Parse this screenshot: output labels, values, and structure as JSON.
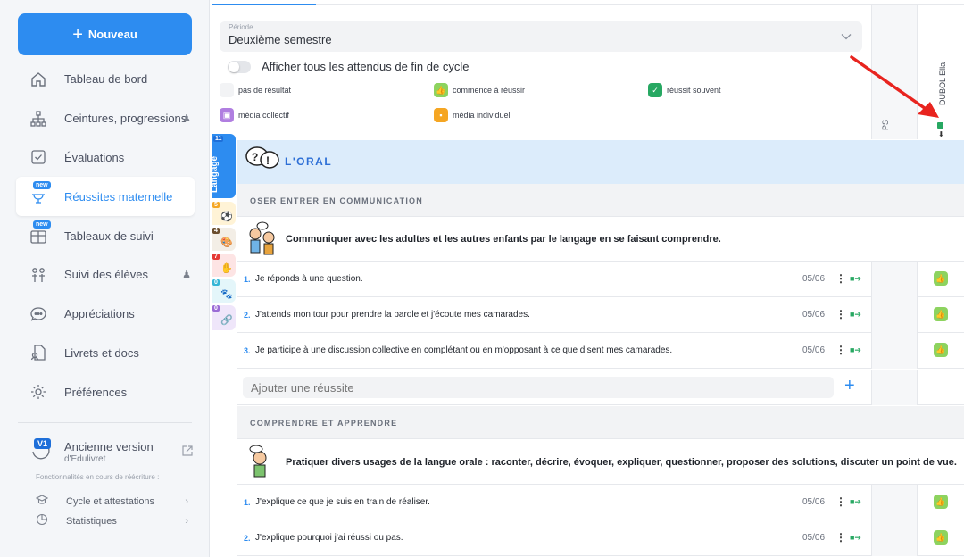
{
  "sidebar": {
    "new_button": "Nouveau",
    "items": [
      {
        "label": "Tableau de bord"
      },
      {
        "label": "Ceintures, progressions"
      },
      {
        "label": "Évaluations"
      },
      {
        "label": "Réussites maternelle",
        "badge": "new"
      },
      {
        "label": "Tableaux de suivi",
        "badge": "new"
      },
      {
        "label": "Suivi des élèves"
      },
      {
        "label": "Appréciations"
      },
      {
        "label": "Livrets et docs"
      },
      {
        "label": "Préférences"
      }
    ],
    "old_version": {
      "badge": "V1",
      "title": "Ancienne version",
      "subtitle": "d'Edulivret"
    },
    "wip_text": "Fonctionnalités en cours de réécriture :",
    "sub_items": [
      {
        "label": "Cycle et attestations"
      },
      {
        "label": "Statistiques"
      }
    ]
  },
  "filters": {
    "periode_label": "Période",
    "periode_value": "Deuxième semestre",
    "toggle_label": "Afficher tous les attendus de fin de cycle",
    "legend": [
      {
        "label": "pas de résultat"
      },
      {
        "label": "commence à réussir"
      },
      {
        "label": "réussit souvent"
      },
      {
        "label": "média collectif"
      },
      {
        "label": "média individuel"
      }
    ]
  },
  "columns": {
    "ps": "PS",
    "student": "DUBOL Ella"
  },
  "domains": [
    {
      "count": "11",
      "label": "Langage"
    },
    {
      "count": "5"
    },
    {
      "count": "4"
    },
    {
      "count": "7"
    },
    {
      "count": "0"
    },
    {
      "count": "0"
    }
  ],
  "main": {
    "domain_title": "L'ORAL",
    "sections": [
      {
        "title": "OSER ENTRER EN COMMUNICATION",
        "objective": "Communiquer avec les adultes et les autres enfants par le langage en se faisant comprendre.",
        "rows": [
          {
            "num": "1.",
            "text": "Je réponds à une question.",
            "date": "05/06"
          },
          {
            "num": "2.",
            "text": "J'attends mon tour pour prendre la parole et j'écoute mes camarades.",
            "date": "05/06"
          },
          {
            "num": "3.",
            "text": "Je participe à une discussion collective en complétant ou en m'opposant à ce que disent mes camarades.",
            "date": "05/06"
          }
        ],
        "add_placeholder": "Ajouter une réussite"
      },
      {
        "title": "COMPRENDRE ET APPRENDRE",
        "objective": "Pratiquer divers usages de la langue orale : raconter, décrire, évoquer, expliquer, questionner, proposer des solutions, discuter un point de vue.",
        "rows": [
          {
            "num": "1.",
            "text": "J'explique ce que je suis en train de réaliser.",
            "date": "05/06"
          },
          {
            "num": "2.",
            "text": "J'explique pourquoi j'ai réussi ou pas.",
            "date": "05/06"
          }
        ]
      }
    ]
  },
  "colors": {
    "accent": "#2d8cf0",
    "success_light": "#8dd35f",
    "success_dark": "#27a862"
  }
}
